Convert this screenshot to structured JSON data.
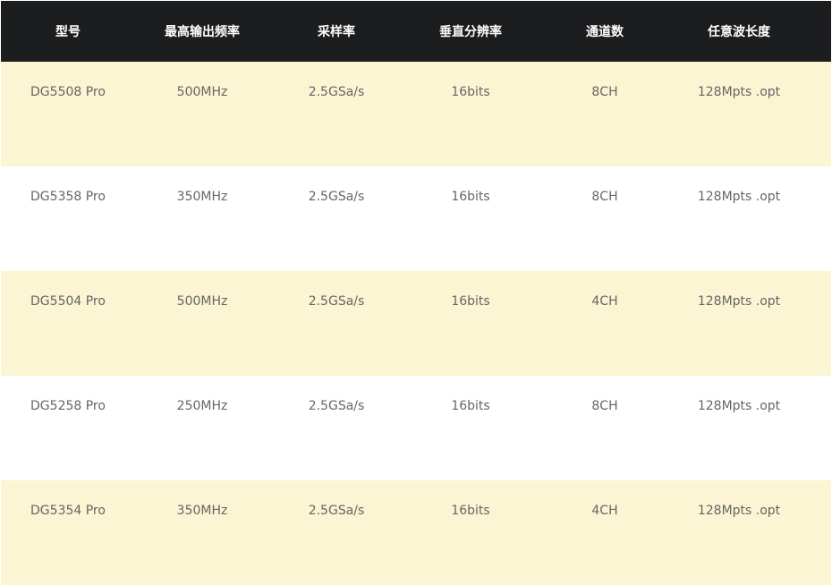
{
  "table": {
    "headers": [
      "型号",
      "最高输出频率",
      "采样率",
      "垂直分辨率",
      "通道数",
      "任意波长度"
    ],
    "rows": [
      [
        "DG5508 Pro",
        "500MHz",
        "2.5GSa/s",
        "16bits",
        "8CH",
        "128Mpts .opt"
      ],
      [
        "DG5358 Pro",
        "350MHz",
        "2.5GSa/s",
        "16bits",
        "8CH",
        "128Mpts .opt"
      ],
      [
        "DG5504 Pro",
        "500MHz",
        "2.5GSa/s",
        "16bits",
        "4CH",
        "128Mpts .opt"
      ],
      [
        "DG5258 Pro",
        "250MHz",
        "2.5GSa/s",
        "16bits",
        "8CH",
        "128Mpts .opt"
      ],
      [
        "DG5354 Pro",
        "350MHz",
        "2.5GSa/s",
        "16bits",
        "4CH",
        "128Mpts .opt"
      ]
    ]
  },
  "colors": {
    "header_background": "#1c1d1f",
    "header_text": "#ffffff",
    "row_highlight": "#fbf5d3",
    "row_plain": "#ffffff",
    "cell_text": "#666666"
  }
}
